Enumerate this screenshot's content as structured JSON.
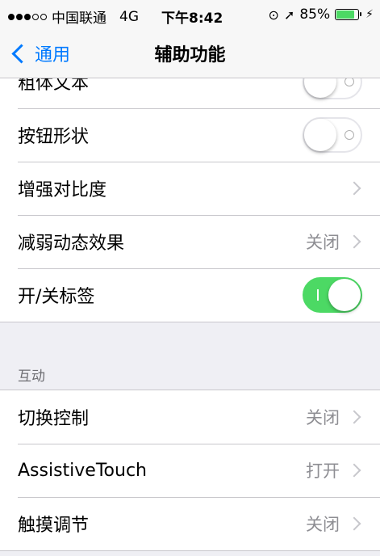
{
  "status_bar": {
    "carrier": "中国联通",
    "network": "4G",
    "time": "下午8:42",
    "battery_percent": "85%",
    "battery_level": 0.85,
    "signal_filled": 3,
    "signal_total": 5,
    "lock_icon": "orientation-lock-icon",
    "location_icon": "location-arrow-icon",
    "charging_icon": "charging-bolt-icon",
    "battery_color": "#4cd964"
  },
  "nav": {
    "back_label": "通用",
    "title": "辅助功能"
  },
  "group1": {
    "rows": [
      {
        "label": "粗体文本",
        "type": "toggle",
        "on": false
      },
      {
        "label": "按钮形状",
        "type": "toggle",
        "on": false
      },
      {
        "label": "增强对比度",
        "type": "disclosure",
        "value": ""
      },
      {
        "label": "减弱动态效果",
        "type": "disclosure",
        "value": "关闭"
      },
      {
        "label": "开/关标签",
        "type": "toggle",
        "on": true
      }
    ]
  },
  "section_interaction": {
    "header": "互动",
    "rows": [
      {
        "label": "切换控制",
        "type": "disclosure",
        "value": "关闭"
      },
      {
        "label": "AssistiveTouch",
        "type": "disclosure",
        "value": "打开"
      },
      {
        "label": "触摸调节",
        "type": "disclosure",
        "value": "关闭"
      }
    ]
  },
  "colors": {
    "accent": "#007aff",
    "toggle_on": "#4cd964",
    "secondary_text": "#8e8e93",
    "background": "#efeff4"
  }
}
